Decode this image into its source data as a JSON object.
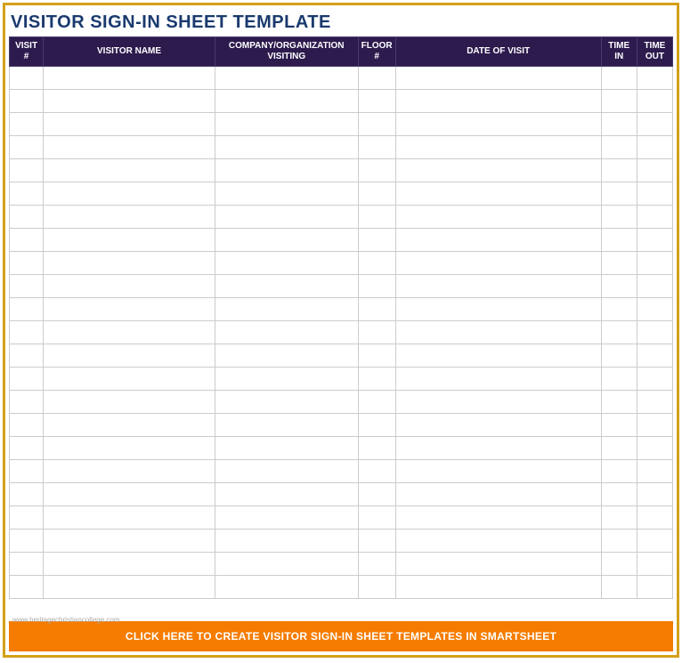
{
  "title": "VISITOR SIGN-IN SHEET TEMPLATE",
  "columns": {
    "visit": "VISIT #",
    "name": "VISITOR NAME",
    "company": "COMPANY/ORGANIZATION VISITING",
    "floor": "FLOOR #",
    "date": "DATE OF VISIT",
    "timein": "TIME IN",
    "timeout": "TIME OUT"
  },
  "rows": [
    {
      "visit": "",
      "name": "",
      "company": "",
      "floor": "",
      "date": "",
      "timein": "",
      "timeout": ""
    },
    {
      "visit": "",
      "name": "",
      "company": "",
      "floor": "",
      "date": "",
      "timein": "",
      "timeout": ""
    },
    {
      "visit": "",
      "name": "",
      "company": "",
      "floor": "",
      "date": "",
      "timein": "",
      "timeout": ""
    },
    {
      "visit": "",
      "name": "",
      "company": "",
      "floor": "",
      "date": "",
      "timein": "",
      "timeout": ""
    },
    {
      "visit": "",
      "name": "",
      "company": "",
      "floor": "",
      "date": "",
      "timein": "",
      "timeout": ""
    },
    {
      "visit": "",
      "name": "",
      "company": "",
      "floor": "",
      "date": "",
      "timein": "",
      "timeout": ""
    },
    {
      "visit": "",
      "name": "",
      "company": "",
      "floor": "",
      "date": "",
      "timein": "",
      "timeout": ""
    },
    {
      "visit": "",
      "name": "",
      "company": "",
      "floor": "",
      "date": "",
      "timein": "",
      "timeout": ""
    },
    {
      "visit": "",
      "name": "",
      "company": "",
      "floor": "",
      "date": "",
      "timein": "",
      "timeout": ""
    },
    {
      "visit": "",
      "name": "",
      "company": "",
      "floor": "",
      "date": "",
      "timein": "",
      "timeout": ""
    },
    {
      "visit": "",
      "name": "",
      "company": "",
      "floor": "",
      "date": "",
      "timein": "",
      "timeout": ""
    },
    {
      "visit": "",
      "name": "",
      "company": "",
      "floor": "",
      "date": "",
      "timein": "",
      "timeout": ""
    },
    {
      "visit": "",
      "name": "",
      "company": "",
      "floor": "",
      "date": "",
      "timein": "",
      "timeout": ""
    },
    {
      "visit": "",
      "name": "",
      "company": "",
      "floor": "",
      "date": "",
      "timein": "",
      "timeout": ""
    },
    {
      "visit": "",
      "name": "",
      "company": "",
      "floor": "",
      "date": "",
      "timein": "",
      "timeout": ""
    },
    {
      "visit": "",
      "name": "",
      "company": "",
      "floor": "",
      "date": "",
      "timein": "",
      "timeout": ""
    },
    {
      "visit": "",
      "name": "",
      "company": "",
      "floor": "",
      "date": "",
      "timein": "",
      "timeout": ""
    },
    {
      "visit": "",
      "name": "",
      "company": "",
      "floor": "",
      "date": "",
      "timein": "",
      "timeout": ""
    },
    {
      "visit": "",
      "name": "",
      "company": "",
      "floor": "",
      "date": "",
      "timein": "",
      "timeout": ""
    },
    {
      "visit": "",
      "name": "",
      "company": "",
      "floor": "",
      "date": "",
      "timein": "",
      "timeout": ""
    },
    {
      "visit": "",
      "name": "",
      "company": "",
      "floor": "",
      "date": "",
      "timein": "",
      "timeout": ""
    },
    {
      "visit": "",
      "name": "",
      "company": "",
      "floor": "",
      "date": "",
      "timein": "",
      "timeout": ""
    },
    {
      "visit": "",
      "name": "",
      "company": "",
      "floor": "",
      "date": "",
      "timein": "",
      "timeout": ""
    }
  ],
  "watermark": "www.heritagechristiancollege.com",
  "footer_button": "CLICK HERE TO CREATE VISITOR SIGN-IN SHEET TEMPLATES IN SMARTSHEET"
}
